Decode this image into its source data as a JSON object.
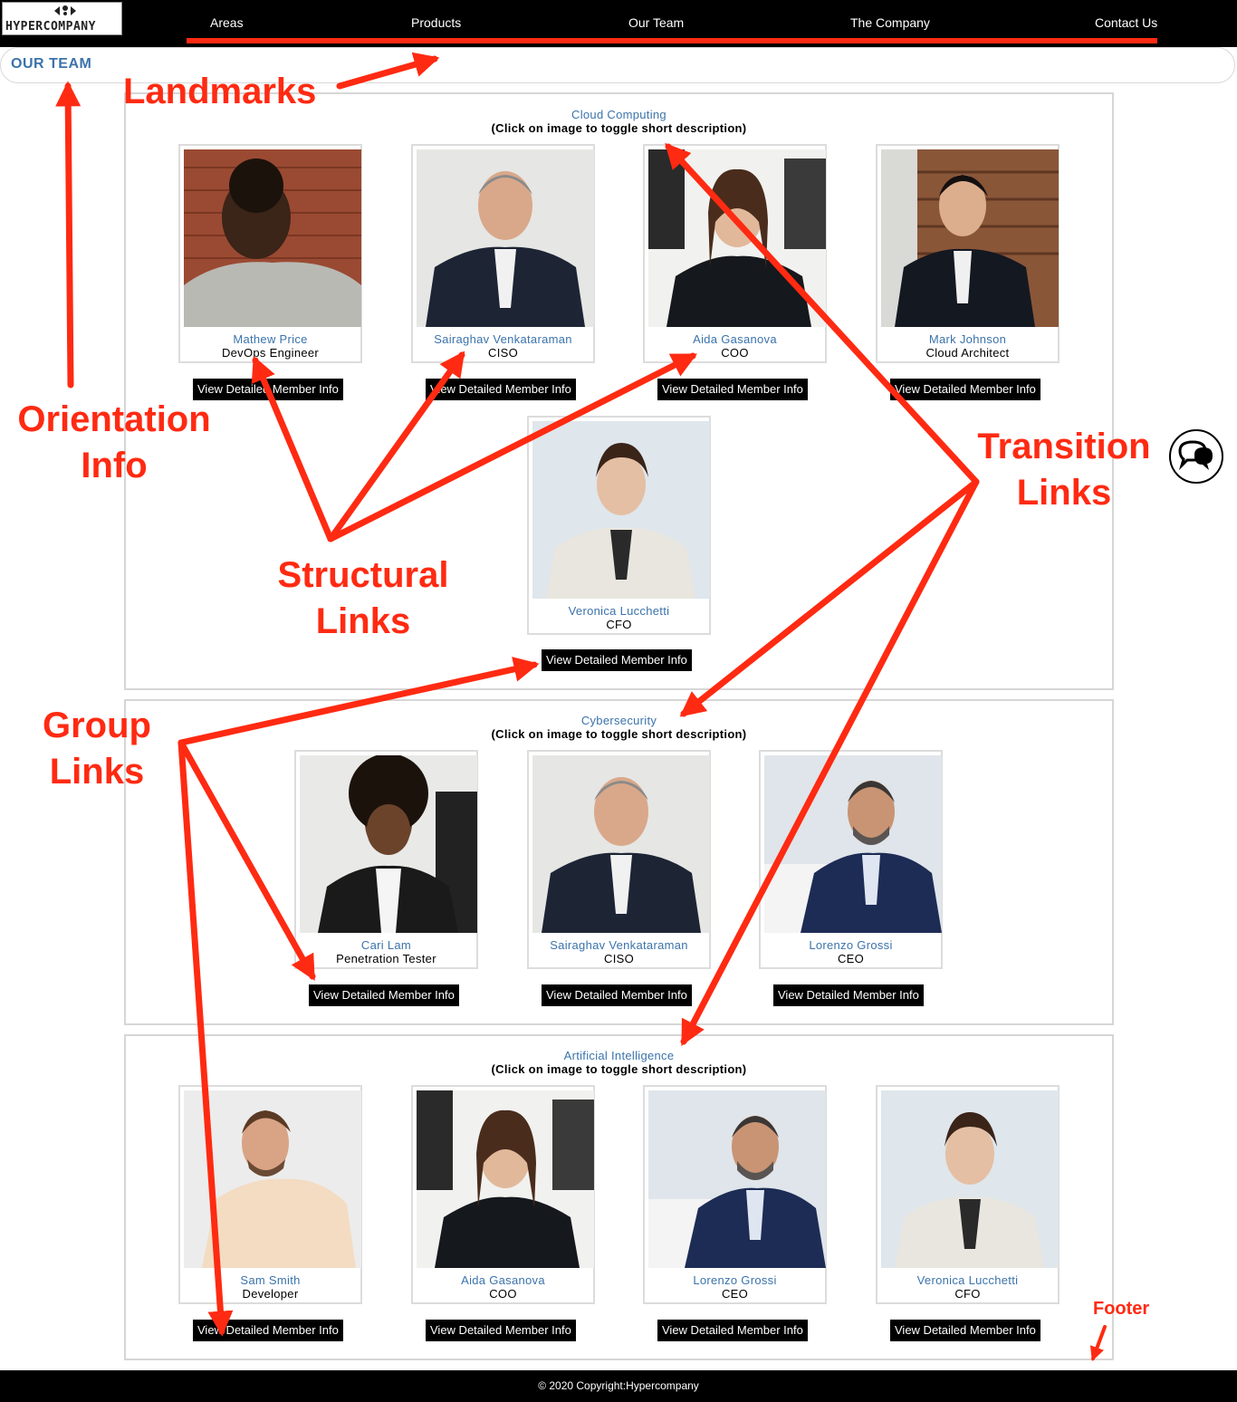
{
  "header": {
    "logo_text": "HYPERCOMPANY",
    "nav": [
      {
        "label": "Areas"
      },
      {
        "label": "Products"
      },
      {
        "label": "Our Team"
      },
      {
        "label": "The Company"
      },
      {
        "label": "Contact Us"
      }
    ]
  },
  "breadcrumb": {
    "label": "OUR TEAM"
  },
  "button_label": "View Detailed Member Info",
  "sections": [
    {
      "title": "Cloud Computing",
      "subtitle": "(Click on image to toggle short description)",
      "members": [
        {
          "name": "Mathew Price",
          "role": "DevOps Engineer"
        },
        {
          "name": "Sairaghav Venkataraman",
          "role": "CISO"
        },
        {
          "name": "Aida Gasanova",
          "role": "COO"
        },
        {
          "name": "Mark Johnson",
          "role": "Cloud Architect"
        },
        {
          "name": "Veronica Lucchetti",
          "role": "CFO"
        }
      ]
    },
    {
      "title": "Cybersecurity",
      "subtitle": "(Click on image to toggle short description)",
      "members": [
        {
          "name": "Cari Lam",
          "role": "Penetration Tester"
        },
        {
          "name": "Sairaghav Venkataraman",
          "role": "CISO"
        },
        {
          "name": "Lorenzo Grossi",
          "role": "CEO"
        }
      ]
    },
    {
      "title": "Artificial Intelligence",
      "subtitle": "(Click on image to toggle short description)",
      "members": [
        {
          "name": "Sam Smith",
          "role": "Developer"
        },
        {
          "name": "Aida Gasanova",
          "role": "COO"
        },
        {
          "name": "Lorenzo Grossi",
          "role": "CEO"
        },
        {
          "name": "Veronica Lucchetti",
          "role": "CFO"
        }
      ]
    }
  ],
  "annotations": {
    "landmarks": "Landmarks",
    "orientation_1": "Orientation",
    "orientation_2": "Info",
    "structural_1": "Structural",
    "structural_2": "Links",
    "transition_1": "Transition",
    "transition_2": "Links",
    "group_1": "Group",
    "group_2": "Links",
    "footer": "Footer"
  },
  "footer": {
    "text": "© 2020 Copyright:Hypercompany"
  },
  "colors": {
    "accent_blue": "#3b73ab",
    "annotation_red": "#ff2a12",
    "nav_bg": "#000000"
  },
  "icons": {
    "chat": "chat-bubbles-icon"
  }
}
